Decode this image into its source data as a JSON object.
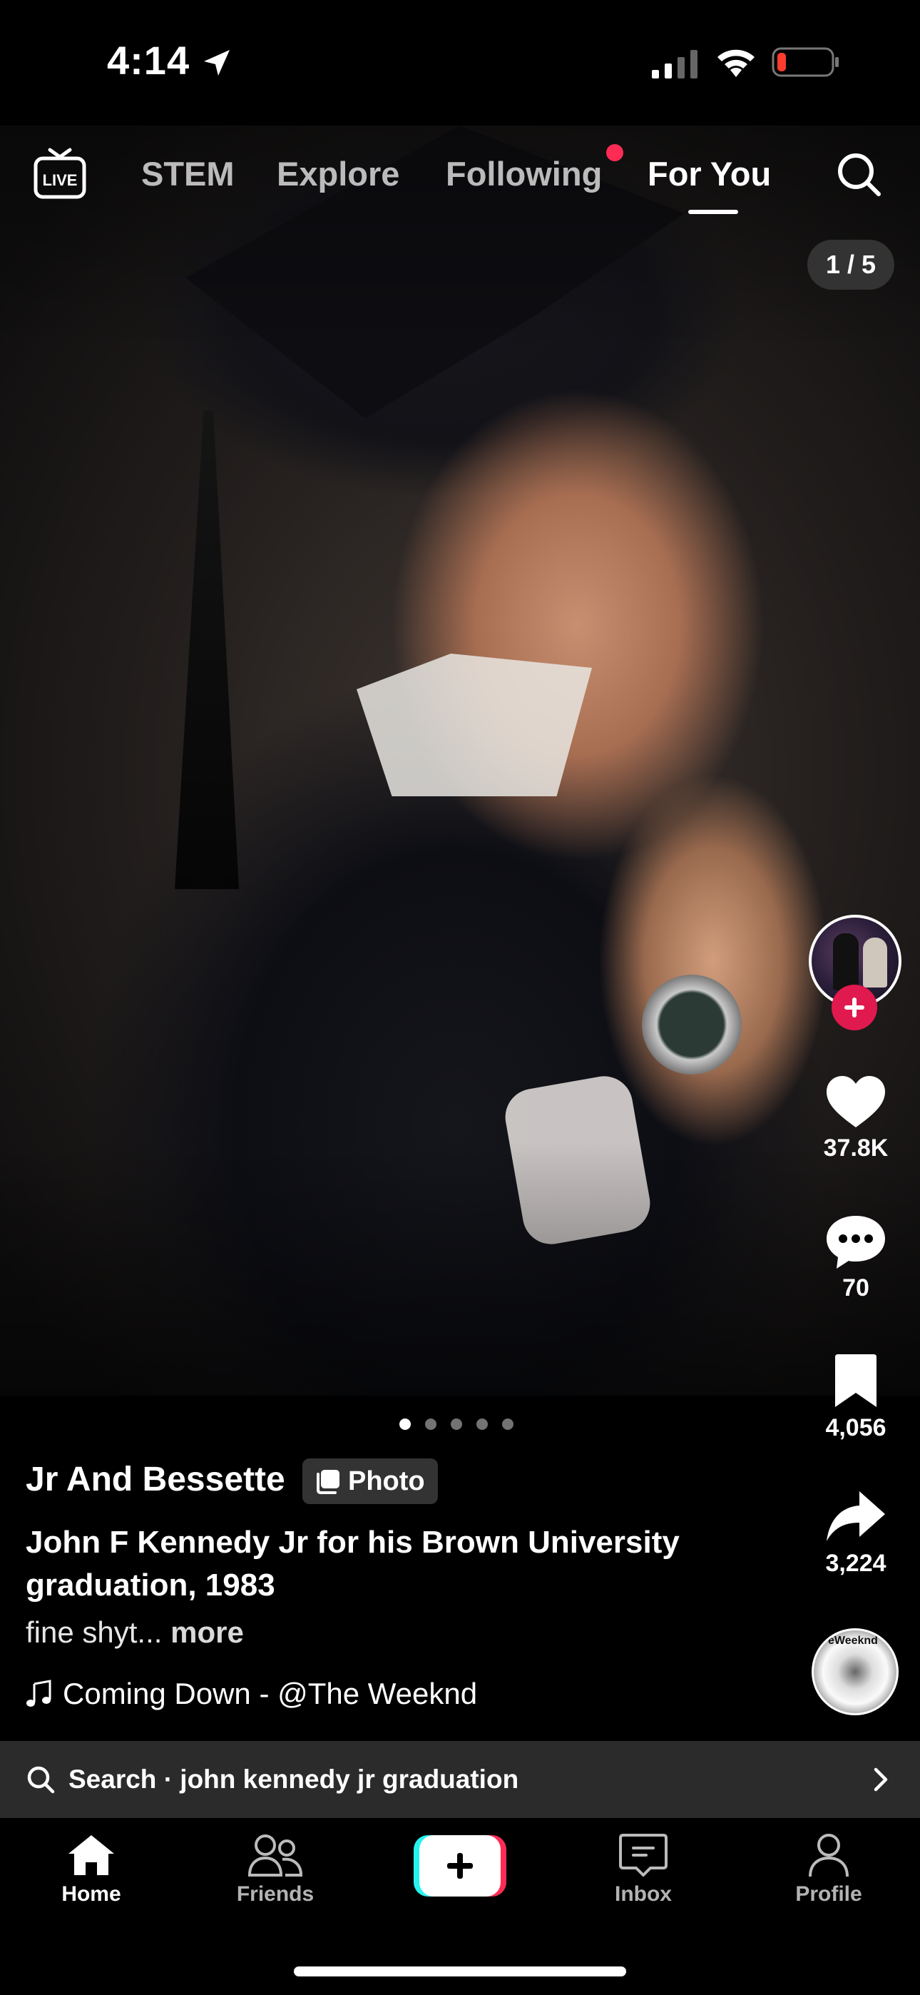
{
  "status_bar": {
    "time": "4:14"
  },
  "top_nav": {
    "live_label": "LIVE",
    "tabs": [
      {
        "label": "STEM"
      },
      {
        "label": "Explore"
      },
      {
        "label": "Following"
      },
      {
        "label": "For You"
      }
    ],
    "active_tab": "For You"
  },
  "post": {
    "page_counter": "1 / 5",
    "slide_index": 1,
    "slide_total": 5,
    "author": "Jr And Bessette",
    "badge": "Photo",
    "caption": "John F Kennedy Jr for his Brown University graduation, 1983",
    "description": "fine shyt...",
    "more_label": "more",
    "music": "Coming Down - @The Weeknd",
    "music_disc_label": "eWeeknd"
  },
  "actions": {
    "likes": "37.8K",
    "comments": "70",
    "bookmarks": "4,056",
    "shares": "3,224"
  },
  "search_suggestion": {
    "label": "Search · john kennedy jr graduation"
  },
  "bottom_nav": {
    "items": [
      {
        "label": "Home",
        "icon": "home-icon"
      },
      {
        "label": "Friends",
        "icon": "friends-icon"
      },
      {
        "label": "",
        "icon": "create-icon"
      },
      {
        "label": "Inbox",
        "icon": "inbox-icon"
      },
      {
        "label": "Profile",
        "icon": "profile-icon"
      }
    ]
  },
  "colors": {
    "accent_red": "#fe2c55",
    "follow_red": "#e0194e",
    "accent_cyan": "#25f4ee",
    "background": "#000000"
  }
}
